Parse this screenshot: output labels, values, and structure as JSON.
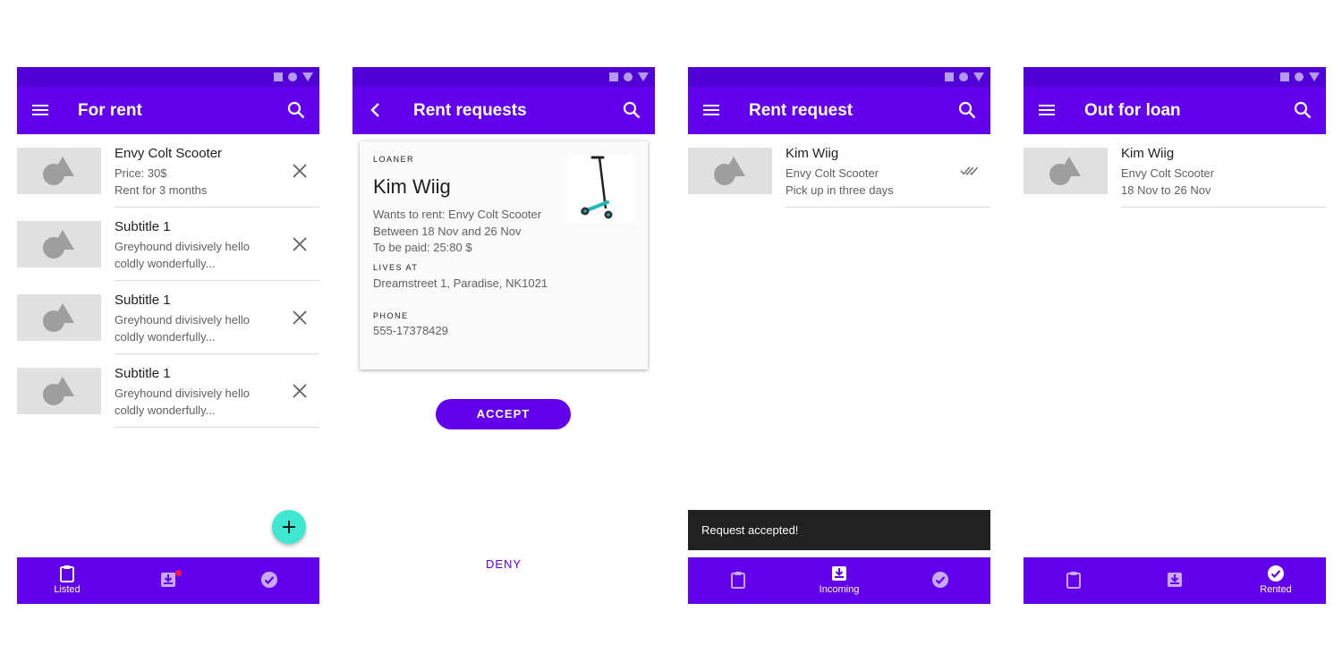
{
  "colors": {
    "primary": "#6200ee",
    "status_bar": "#5000d6",
    "fab": "#3ee8d0",
    "snackbar": "#212121",
    "badge": "#ff1744"
  },
  "screens": [
    {
      "title": "For rent",
      "leading_icon": "menu-icon",
      "items": [
        {
          "title": "Envy Colt Scooter",
          "line1": "Price: 30$",
          "line2": "Rent for 3 months",
          "trailing_icon": "close-icon"
        },
        {
          "title": "Subtitle 1",
          "line1": "Greyhound divisively hello",
          "line2": "coldly wonderfully...",
          "trailing_icon": "close-icon"
        },
        {
          "title": "Subtitle 1",
          "line1": "Greyhound divisively hello",
          "line2": "coldly wonderfully...",
          "trailing_icon": "close-icon"
        },
        {
          "title": "Subtitle 1",
          "line1": "Greyhound divisively hello",
          "line2": "coldly wonderfully...",
          "trailing_icon": "close-icon"
        }
      ],
      "fab_icon": "add-icon",
      "nav": [
        {
          "label": "Listed",
          "icon": "clipboard-icon",
          "active": true
        },
        {
          "label": "",
          "icon": "inbox-download-icon",
          "active": false,
          "badge": true
        },
        {
          "label": "",
          "icon": "check-circle-icon",
          "active": false
        }
      ]
    },
    {
      "title": "Rent requests",
      "leading_icon": "back-arrow-icon",
      "card": {
        "loaner_label": "LOANER",
        "name": "Kim Wiig",
        "wants": "Wants to rent: Envy Colt Scooter",
        "between": "Between 18 Nov and 26 Nov",
        "paid": "To be paid: 25:80 $",
        "lives_label": "LIVES AT",
        "address": "Dreamstreet 1, Paradise, NK1021",
        "phone_label": "PHONE",
        "phone": "555-17378429",
        "image_icon": "scooter-image"
      },
      "accept": "ACCEPT",
      "deny": "DENY"
    },
    {
      "title": "Rent request",
      "leading_icon": "menu-icon",
      "items": [
        {
          "title": "Kim Wiig",
          "line1": "Envy Colt Scooter",
          "line2": "Pick up in three days",
          "trailing_icon": "double-check-icon"
        }
      ],
      "snackbar": "Request accepted!",
      "nav": [
        {
          "label": "",
          "icon": "clipboard-icon",
          "active": false
        },
        {
          "label": "Incoming",
          "icon": "inbox-download-icon",
          "active": true
        },
        {
          "label": "",
          "icon": "check-circle-icon",
          "active": false
        }
      ]
    },
    {
      "title": "Out for loan",
      "leading_icon": "menu-icon",
      "items": [
        {
          "title": "Kim Wiig",
          "line1": "Envy Colt Scooter",
          "line2": "18 Nov to 26 Nov"
        }
      ],
      "nav": [
        {
          "label": "",
          "icon": "clipboard-icon",
          "active": false
        },
        {
          "label": "",
          "icon": "inbox-download-icon",
          "active": false
        },
        {
          "label": "Rented",
          "icon": "check-circle-icon",
          "active": true
        }
      ]
    }
  ]
}
